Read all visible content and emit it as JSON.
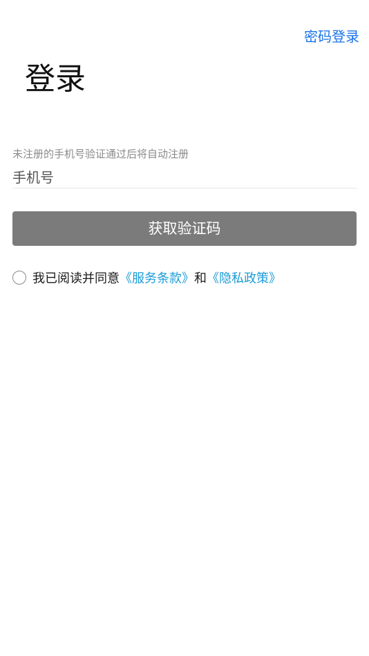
{
  "header": {
    "password_login_link": "密码登录"
  },
  "page": {
    "title": "登录"
  },
  "form": {
    "hint": "未注册的手机号验证通过后将自动注册",
    "phone_placeholder": "手机号",
    "phone_value": "",
    "submit_label": "获取验证码"
  },
  "agreement": {
    "checked": false,
    "prefix": "我已阅读并同意",
    "terms_link": "《服务条款》",
    "conjunction": "和",
    "privacy_link": "《隐私政策》"
  },
  "colors": {
    "accent_link": "#1a73e8",
    "agreement_link": "#1a9bd7",
    "disabled_button": "#7b7b7b"
  }
}
